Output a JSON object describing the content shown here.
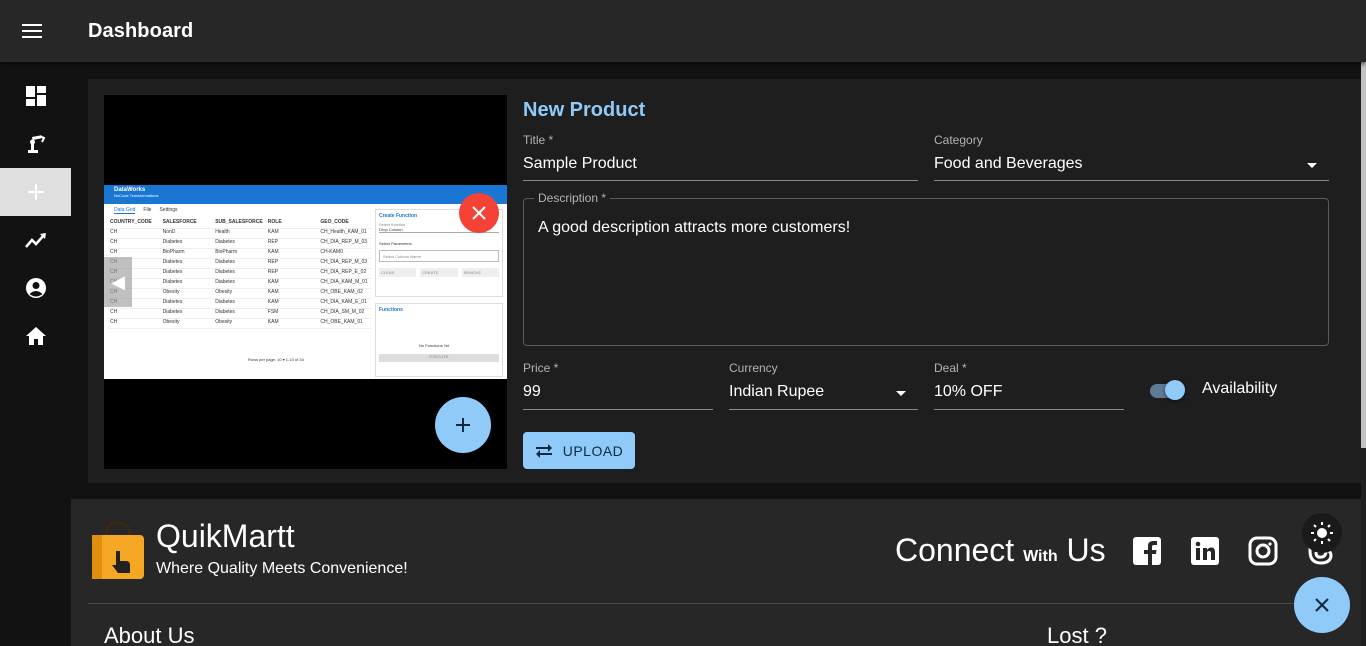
{
  "appbar": {
    "title": "Dashboard"
  },
  "nav": {
    "items": [
      {
        "icon": "dashboard-icon"
      },
      {
        "icon": "robot-arm-icon"
      },
      {
        "icon": "add-icon",
        "active": true
      },
      {
        "icon": "trending-icon"
      },
      {
        "icon": "account-icon"
      },
      {
        "icon": "home-icon"
      }
    ]
  },
  "preview": {
    "header_title": "DataWorks",
    "header_subtitle": "NoCode Transformations",
    "tab": "Data Grid",
    "menu_file": "File",
    "menu_settings": "Settings",
    "columns": [
      "COUNTRY_CODE",
      "SALESFORCE",
      "SUB_SALESFORCE",
      "ROLE",
      "GEO_CODE"
    ],
    "rows": [
      [
        "CH",
        "NonD",
        "Health",
        "KAM",
        "CH_Health_KAM_01"
      ],
      [
        "CH",
        "Diabetes",
        "Diabetes",
        "REP",
        "CH_DIA_REP_M_03"
      ],
      [
        "CH",
        "BioPharm",
        "BioPharm",
        "KAM",
        "CH-KAM0"
      ],
      [
        "CH",
        "Diabetes",
        "Diabetes",
        "REP",
        "CH_DIA_REP_M_03"
      ],
      [
        "CH",
        "Diabetes",
        "Diabetes",
        "REP",
        "CH_DIA_REP_E_02"
      ],
      [
        "CH",
        "Diabetes",
        "Diabetes",
        "KAM",
        "CH_DIA_KAM_M_01"
      ],
      [
        "CH",
        "Obesity",
        "Obesity",
        "KAM",
        "CH_OBE_KAM_02"
      ],
      [
        "CH",
        "Diabetes",
        "Diabetes",
        "KAM",
        "CH_DIA_KAM_E_01"
      ],
      [
        "CH",
        "Diabetes",
        "Diabetes",
        "FSM",
        "CH_DIA_SM_M_02"
      ],
      [
        "CH",
        "Obesity",
        "Obesity",
        "KAM",
        "CH_OBE_KAM_01"
      ]
    ],
    "pager": "Rows per page: 10 ▾ 1-10 of 34",
    "panel_title": "Create Function",
    "panel_select_label": "Select function",
    "panel_select_value": "Drop Column",
    "panel_params": "Select Parameters",
    "panel_param_placeholder": "Select Column Name",
    "panel_btn_clear": "CLEAR",
    "panel_btn_create": "CREATE",
    "panel_btn_remove": "REMOVE",
    "functions_title": "Functions",
    "functions_empty": "No Functions Yet",
    "functions_execute": "EXECUTE"
  },
  "form": {
    "title": "New Product",
    "title_label": "Title *",
    "title_value": "Sample Product",
    "category_label": "Category",
    "category_value": "Food and Beverages",
    "description_label": "Description *",
    "description_value": "A good description attracts more customers!",
    "price_label": "Price *",
    "price_value": "99",
    "currency_label": "Currency",
    "currency_value": "Indian Rupee",
    "deal_label": "Deal *",
    "deal_value": "10% OFF",
    "availability_label": "Availability",
    "availability_on": true,
    "upload_label": "UPLOAD"
  },
  "footer": {
    "brand_name": "QuikMartt",
    "tagline": "Where Quality Meets Convenience!",
    "connect_pre": "Connect",
    "connect_mid": "With",
    "connect_post": "Us",
    "social": [
      "facebook-icon",
      "linkedin-icon",
      "instagram-icon",
      "threads-icon"
    ],
    "about": "About Us",
    "lost": "Lost ?"
  },
  "colors": {
    "accent": "#90caf9",
    "danger": "#f44336",
    "brand_orange": "#f5a623"
  }
}
